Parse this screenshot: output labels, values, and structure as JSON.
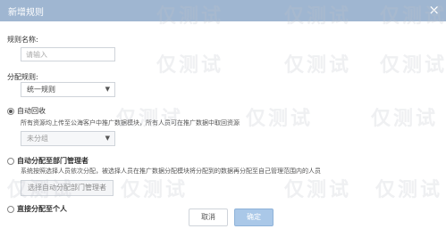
{
  "dialog": {
    "title": "新增规则",
    "close_glyph": "×"
  },
  "form": {
    "rule_name_label": "规则名称:",
    "rule_name_placeholder": "请输入",
    "assign_label": "分配规则:",
    "assign_value": "统一规则",
    "auto_recycle": {
      "label": "自动回收",
      "desc": "所有资源均上传至公海客户中推广数据模块，所有人员可在推广数据中取回资源",
      "select_value": "未分组"
    },
    "auto_assign": {
      "label": "自动分配至部门管理者",
      "desc": "系统按照选择人员依次分配，被选择人员在推广数据分配模块将分配到的数据再分配至自己管理范围内的人员",
      "button_label": "选择自动分配部门管理者"
    },
    "direct_assign": {
      "label": "直接分配至个人"
    }
  },
  "footer": {
    "cancel_label": "取消",
    "confirm_label": "确定"
  },
  "watermark": {
    "text": "仅测试"
  }
}
